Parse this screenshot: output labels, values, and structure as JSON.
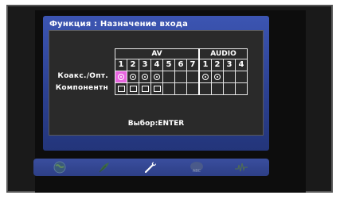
{
  "osd": {
    "title": "Функция : Назначение входа",
    "group_headers": [
      "AV",
      "AUDIO"
    ],
    "av_columns": [
      "1",
      "2",
      "3",
      "4",
      "5",
      "6",
      "7"
    ],
    "audio_columns": [
      "1",
      "2",
      "3",
      "4"
    ],
    "rows": [
      {
        "label": "Коакс./Опт.",
        "selected_av_column": 1
      },
      {
        "label": "Компонентн"
      }
    ],
    "hint": "Выбор:ENTER"
  },
  "navbar": {
    "icons": [
      "globe-icon",
      "leaf-icon",
      "wrench-icon",
      "abc-icon",
      "signal-icon"
    ],
    "active_icon": "wrench-icon"
  },
  "colors": {
    "osd_blue": "#2c4192",
    "panel_dark": "#2a2a2a",
    "selection_magenta": "#e866e0"
  }
}
